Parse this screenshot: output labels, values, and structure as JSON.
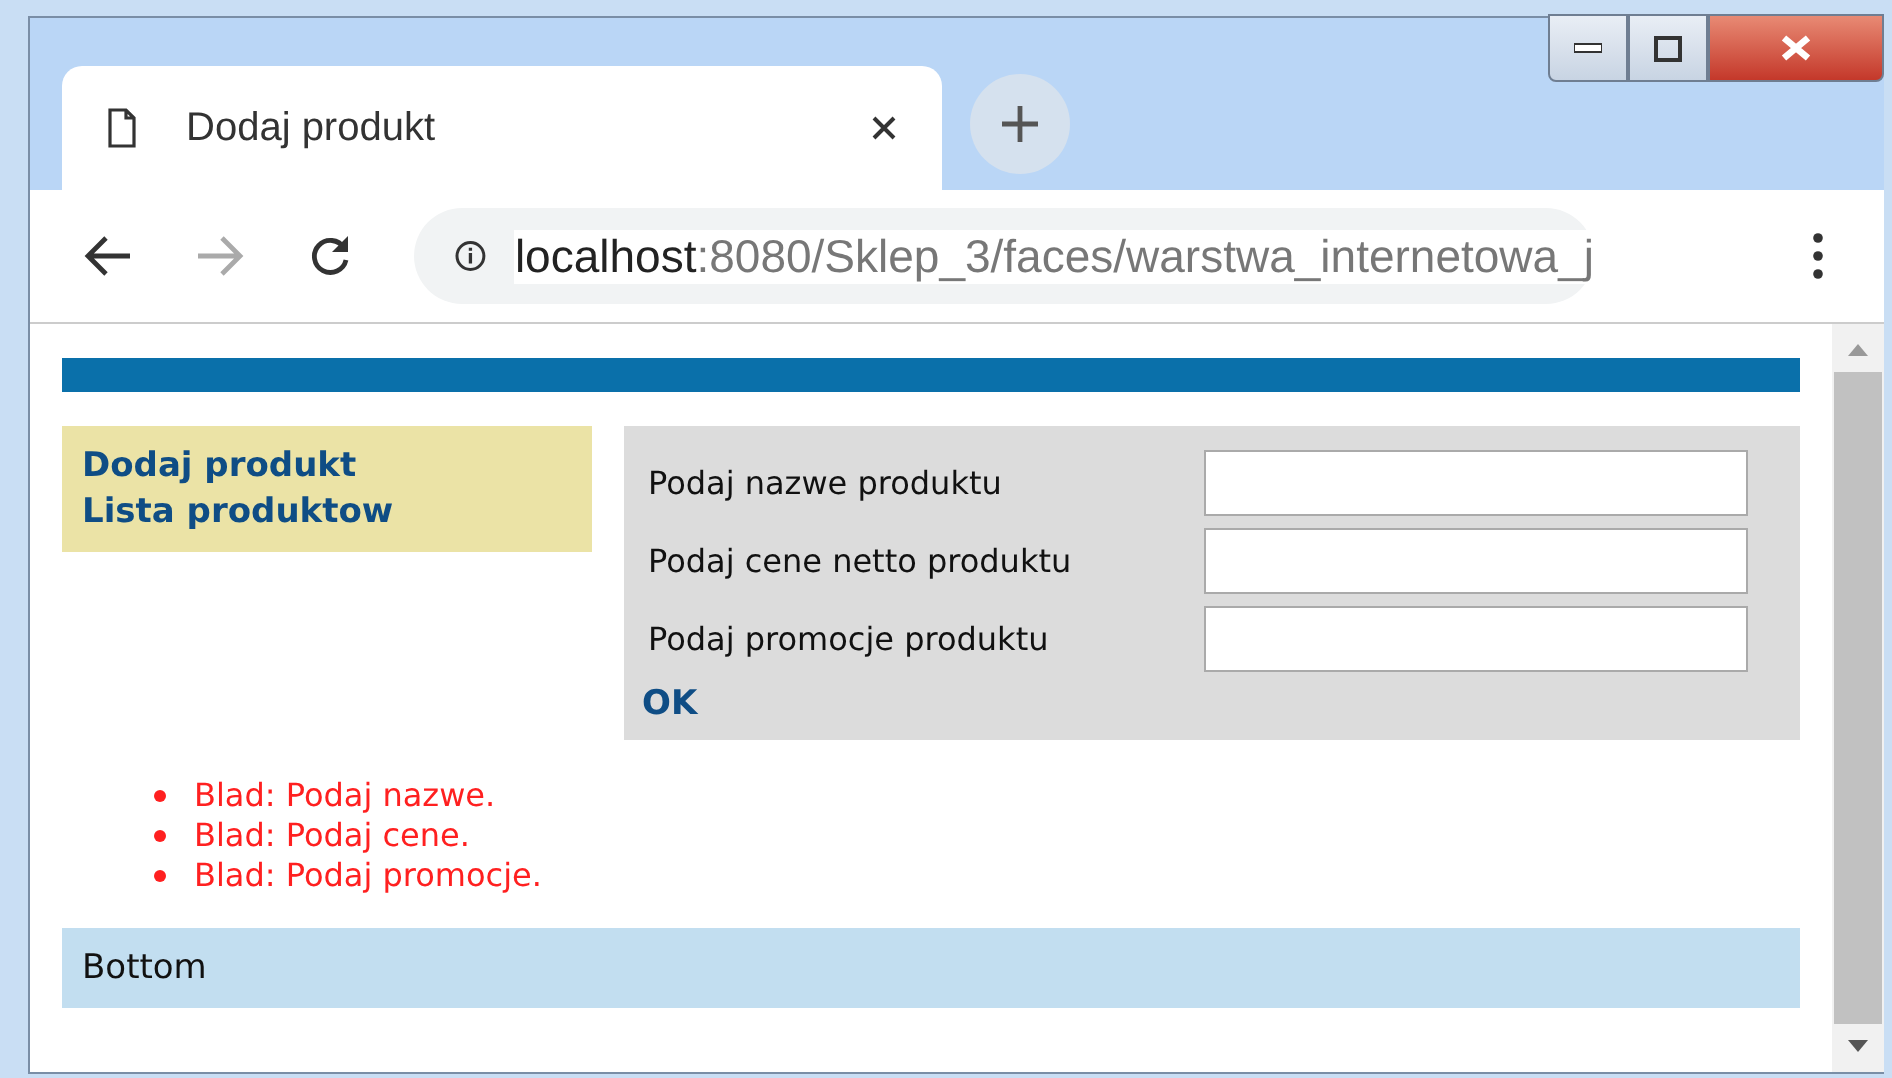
{
  "tab": {
    "title": "Dodaj produkt"
  },
  "address": {
    "host": "localhost",
    "path": ":8080/Sklep_3/faces/warstwa_internetowa_j"
  },
  "nav": [
    "Dodaj produkt",
    "Lista produktow"
  ],
  "form": {
    "fields": [
      {
        "label": "Podaj nazwe produktu"
      },
      {
        "label": "Podaj cene netto produktu"
      },
      {
        "label": "Podaj promocje produktu"
      }
    ],
    "submit": "OK"
  },
  "errors": [
    "Blad: Podaj nazwe.",
    "Blad: Podaj cene.",
    "Blad: Podaj promocje."
  ],
  "footer": "Bottom"
}
